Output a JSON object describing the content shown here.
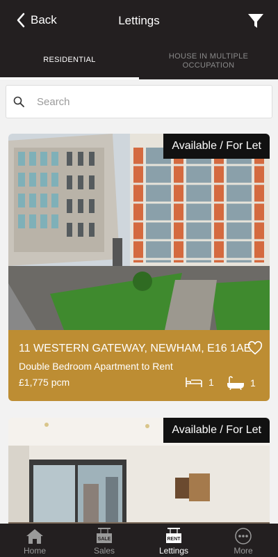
{
  "header": {
    "back_label": "Back",
    "title": "Lettings",
    "back_icon": "chevron-left-icon",
    "filter_icon": "filter-icon"
  },
  "tabs": [
    {
      "label": "RESIDENTIAL",
      "active": true
    },
    {
      "label": "HOUSE IN MULTIPLE OCCUPATION",
      "active": false
    }
  ],
  "search": {
    "placeholder": "Search",
    "value": ""
  },
  "listings": [
    {
      "status": "Available / For Let",
      "address": "11 WESTERN GATEWAY, NEWHAM, E16 1AE",
      "description": "Double Bedroom Apartment to Rent",
      "price": "£1,775 pcm",
      "bedrooms": "1",
      "bathrooms": "1"
    },
    {
      "status": "Available / For Let"
    }
  ],
  "bottom_nav": [
    {
      "label": "Home",
      "icon": "home-icon",
      "active": false
    },
    {
      "label": "Sales",
      "icon": "sale-sign-icon",
      "badge": "SALE",
      "active": false
    },
    {
      "label": "Lettings",
      "icon": "rent-sign-icon",
      "badge": "RENT",
      "active": true
    },
    {
      "label": "More",
      "icon": "more-icon",
      "active": false
    }
  ],
  "colors": {
    "header_bg": "#231f20",
    "card_info_bg": "#bd8d33",
    "page_bg": "#f2f2f2"
  }
}
